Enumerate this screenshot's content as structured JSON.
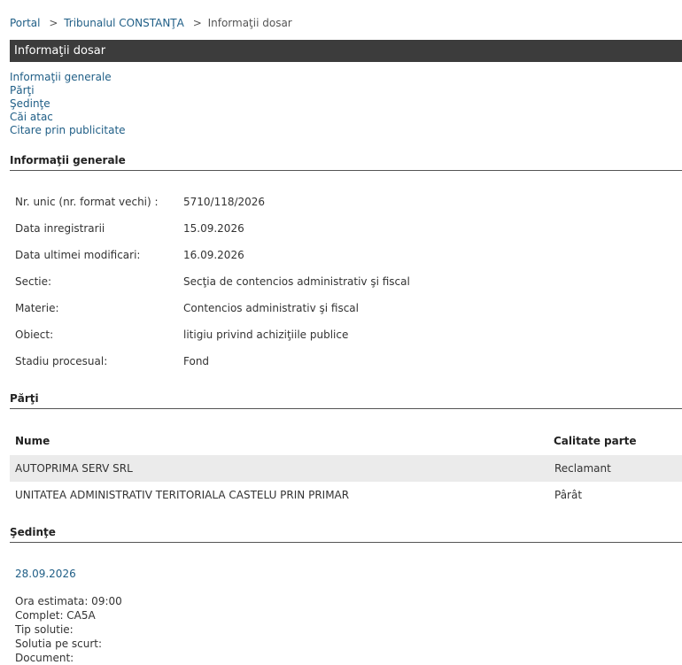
{
  "breadcrumb": {
    "portal": "Portal",
    "sep": ">",
    "tribunal": "Tribunalul CONSTANŢA",
    "current": "Informaţii dosar"
  },
  "title_bar": "Informaţii dosar",
  "nav_links": [
    "Informaţii generale",
    "Părţi",
    "Şedinţe",
    "Căi atac",
    "Citare prin publicitate"
  ],
  "general": {
    "heading": "Informaţii generale",
    "rows": [
      {
        "label": "Nr. unic (nr. format vechi) :",
        "value": "5710/118/2026"
      },
      {
        "label": "Data inregistrarii",
        "value": "15.09.2026"
      },
      {
        "label": "Data ultimei modificari:",
        "value": "16.09.2026"
      },
      {
        "label": "Sectie:",
        "value": "Secţia de contencios administrativ şi fiscal"
      },
      {
        "label": "Materie:",
        "value": "Contencios administrativ şi fiscal"
      },
      {
        "label": "Obiect:",
        "value": "litigiu privind achiziţiile publice"
      },
      {
        "label": "Stadiu procesual:",
        "value": "Fond"
      }
    ]
  },
  "parti": {
    "heading": "Părţi",
    "columns": {
      "name": "Nume",
      "quality": "Calitate parte"
    },
    "rows": [
      {
        "name": "AUTOPRIMA SERV SRL",
        "quality": "Reclamant"
      },
      {
        "name": "UNITATEA ADMINISTRATIV TERITORIALA CASTELU PRIN PRIMAR",
        "quality": "Pârât"
      }
    ]
  },
  "sedinte": {
    "heading": "Şedinţe",
    "date": "28.09.2026",
    "details": [
      "Ora estimata: 09:00",
      "Complet: CA5A",
      "Tip solutie:",
      "Solutia pe scurt:",
      "Document:"
    ]
  }
}
